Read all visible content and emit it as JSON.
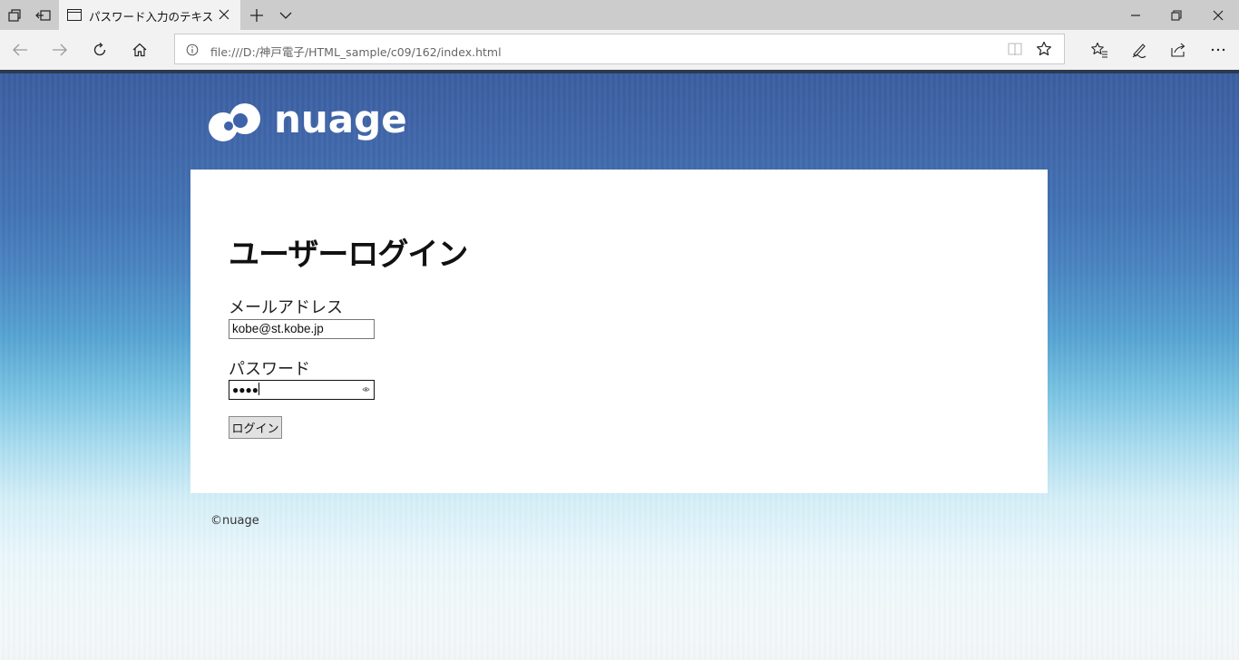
{
  "browser": {
    "tab_title": "パスワード入力のテキストフ-",
    "address": "file:///D:/神戸電子/HTML_sample/c09/162/index.html"
  },
  "page": {
    "logo_text": "nuage",
    "heading": "ユーザーログイン",
    "email_label": "メールアドレス",
    "email_value": "kobe@st.kobe.jp",
    "password_label": "パスワード",
    "password_value": "●●●●",
    "login_button": "ログイン",
    "footer": "©nuage"
  }
}
